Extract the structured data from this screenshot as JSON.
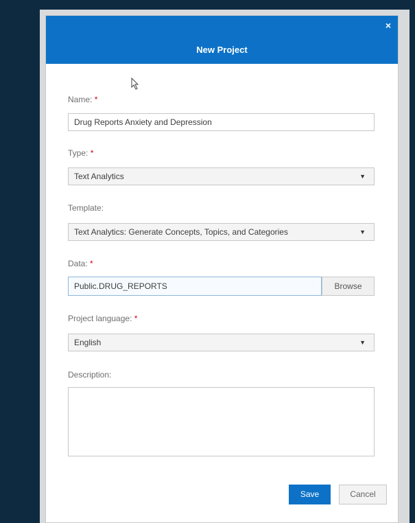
{
  "dialog": {
    "title": "New Project",
    "close_glyph": "×",
    "name_label": "Name:",
    "name_value": "Drug Reports Anxiety and Depression",
    "type_label": "Type:",
    "type_value": "Text Analytics",
    "template_label": "Template:",
    "template_value": "Text Analytics: Generate Concepts, Topics, and Categories",
    "data_label": "Data:",
    "data_value": "Public.DRUG_REPORTS",
    "browse_label": "Browse",
    "language_label": "Project language:",
    "language_value": "English",
    "description_label": "Description:",
    "description_value": "",
    "save_label": "Save",
    "cancel_label": "Cancel",
    "required_marker": "*"
  },
  "icons": {
    "close": "close-icon",
    "dropdown": "chevron-down-icon",
    "cursor": "mouse-cursor-icon"
  },
  "colors": {
    "header": "#0d72c7",
    "primary_button": "#0d72c7",
    "required": "#d0021b",
    "backdrop": "#0d2a40"
  }
}
